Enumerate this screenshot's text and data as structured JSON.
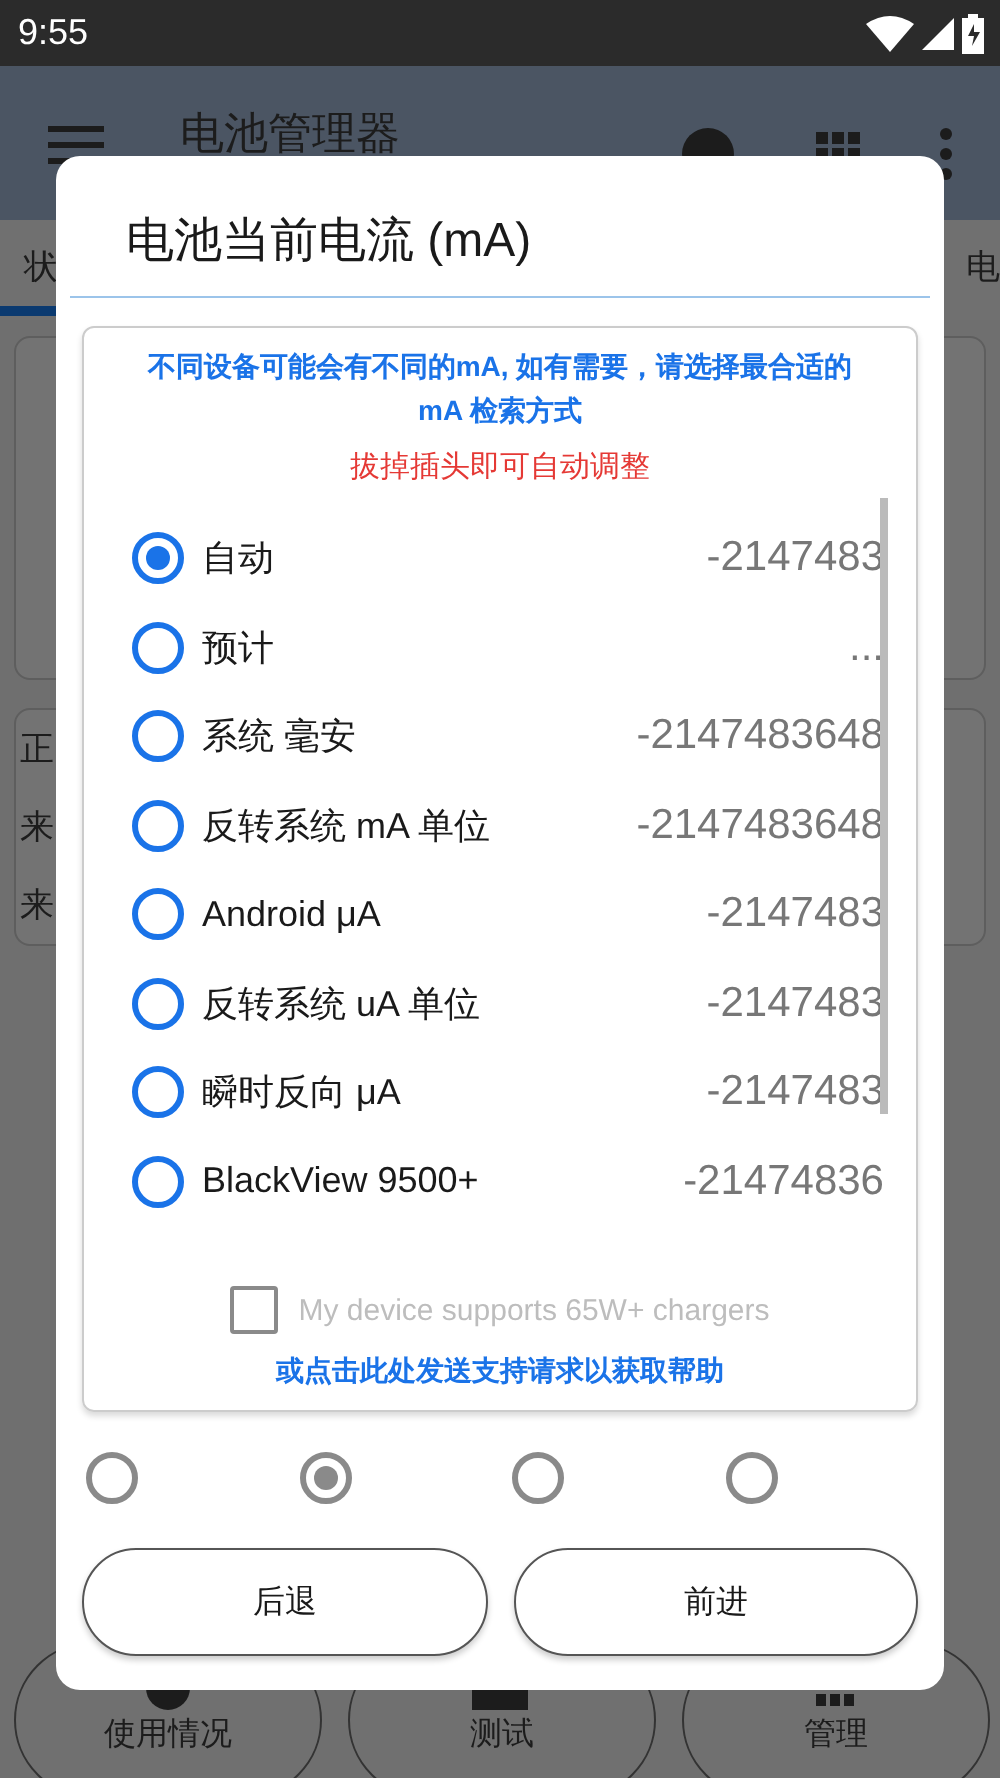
{
  "status_bar": {
    "time": "9:55"
  },
  "app_bar": {
    "title": "电池管理器"
  },
  "tabs": [
    {
      "label": "状",
      "selected": true
    },
    {
      "label": "电",
      "selected": false
    }
  ],
  "background_card": {
    "lines": [
      "正",
      "来",
      "来"
    ]
  },
  "bottom_nav": [
    {
      "label": "使用情况"
    },
    {
      "label": "测试"
    },
    {
      "label": "管理"
    }
  ],
  "dialog": {
    "title": "电池当前电流 (mA)",
    "notice": "不同设备可能会有不同的mA, 如有需要，请选择最合适的 mA 检索方式",
    "warning": "拔掉插头即可自动调整",
    "options": [
      {
        "label": "自动",
        "value": "-2147483",
        "selected": true
      },
      {
        "label": "预计",
        "value": "...",
        "selected": false
      },
      {
        "label": "系统 毫安",
        "value": "-2147483648",
        "selected": false
      },
      {
        "label": "反转系统 mA 单位",
        "value": "-2147483648",
        "selected": false
      },
      {
        "label": "Android μA",
        "value": "-2147483",
        "selected": false
      },
      {
        "label": "反转系统 uA 单位",
        "value": "-2147483",
        "selected": false
      },
      {
        "label": "瞬时反向 μA",
        "value": "-2147483",
        "selected": false
      },
      {
        "label": "BlackView 9500+",
        "value": "-21474836",
        "selected": false
      }
    ],
    "checkbox": {
      "label": "My device supports 65W+ chargers",
      "checked": false,
      "disabled": true
    },
    "help_link": "或点击此处发送支持请求以获取帮助",
    "pages": [
      {
        "selected": false
      },
      {
        "selected": true
      },
      {
        "selected": false
      },
      {
        "selected": false
      }
    ],
    "buttons": [
      "后退",
      "前进"
    ]
  }
}
